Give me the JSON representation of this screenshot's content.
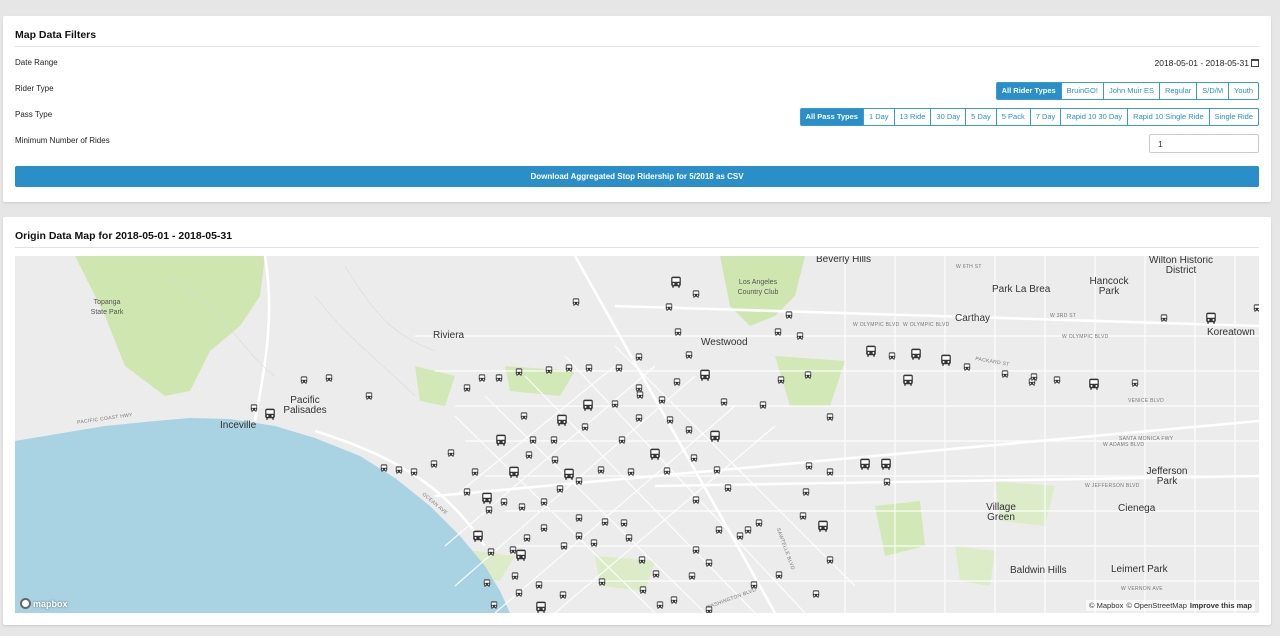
{
  "filters": {
    "title": "Map Data Filters",
    "date_label": "Date Range",
    "date_value": "2018-05-01 - 2018-05-31",
    "rider_label": "Rider Type",
    "rider_types": [
      "All Rider Types",
      "BruinGO!",
      "John Muir ES",
      "Regular",
      "S/D/M",
      "Youth"
    ],
    "rider_active": "All Rider Types",
    "pass_label": "Pass Type",
    "pass_types": [
      "All Pass Types",
      "1 Day",
      "13 Ride",
      "30 Day",
      "5 Day",
      "5 Pack",
      "7 Day",
      "Rapid 10 30 Day",
      "Rapid 10 Single Ride",
      "Single Ride"
    ],
    "pass_active": "All Pass Types",
    "min_rides_label": "Minimum Number of Rides",
    "min_rides_value": "1",
    "download_label": "Download Aggregated Stop Ridership for 5/2018 as CSV"
  },
  "map": {
    "title": "Origin Data Map for 2018-05-01 - 2018-05-31",
    "places": {
      "beverly_hills": "Beverly Hills",
      "wilton": "Wilton Historic District",
      "park_la_brea": "Park La Brea",
      "hancock_park": "Hancock Park",
      "carthay": "Carthay",
      "koreatown": "Koreatown",
      "topanga": "Topanga State Park",
      "riviera": "Riviera",
      "westwood": "Westwood",
      "lacc": "Los Angeles Country Club",
      "pacific_palisades": "Pacific Palisades",
      "inceville": "Inceville",
      "jefferson_park": "Jefferson Park",
      "village_green": "Village Green",
      "cienega": "Cienega",
      "baldwin_hills": "Baldwin Hills",
      "leimert_park": "Leimert Park"
    },
    "roads": {
      "w_olympic_1": "W OLYMPIC BLVD",
      "w_olympic_2": "W OLYMPIC BLVD",
      "w_olympic_3": "W OLYMPIC BLVD",
      "venice": "VENICE BLVD",
      "santa_monica_fwy": "SANTA MONICA FWY",
      "w_jefferson": "W JEFFERSON BLVD",
      "pacific_coast": "PACIFIC COAST HWY",
      "ocean_ave": "OCEAN AVE",
      "sawtelle": "SAWTELLE BLVD",
      "washington": "WASHINGTON BLVD",
      "packard": "PACKARD ST",
      "w_6th": "W 6TH ST",
      "w_adams": "W ADAMS BLVD",
      "w_vernon": "W VERNON AVE",
      "w_3rd": "W 3RD ST"
    },
    "logo": "mapbox",
    "attribution": {
      "mapbox": "© Mapbox",
      "osm": "© OpenStreetMap",
      "improve": "Improve this map"
    },
    "colors": {
      "water": "#a9d2e3",
      "park": "#cfe6b0",
      "land": "#ececec",
      "accent": "#2a8fc9"
    }
  }
}
